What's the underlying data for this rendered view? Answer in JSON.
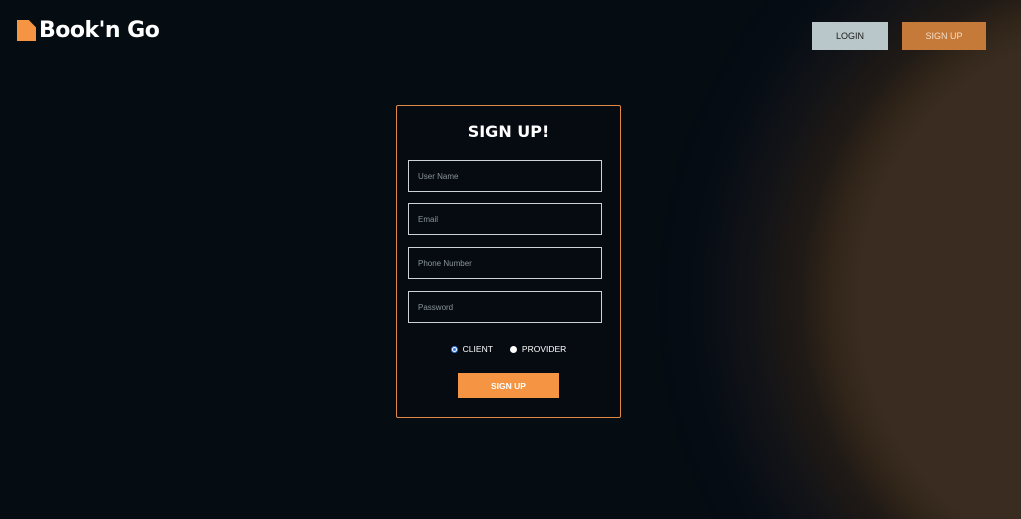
{
  "brand": {
    "name": "Book'n Go"
  },
  "nav": {
    "login_label": "LOGIN",
    "signup_label": "SIGN UP"
  },
  "form": {
    "title": "SIGN UP!",
    "fields": {
      "username_placeholder": "User Name",
      "email_placeholder": "Email",
      "phone_placeholder": "Phone Number",
      "password_placeholder": "Password"
    },
    "roles": [
      {
        "label": "CLIENT",
        "selected": true
      },
      {
        "label": "PROVIDER",
        "selected": false
      }
    ],
    "submit_label": "SIGN UP"
  },
  "colors": {
    "accent": "#f59442",
    "nav_signup": "#c67a3a",
    "nav_login": "#b9c7cb",
    "background": "#050d12"
  }
}
